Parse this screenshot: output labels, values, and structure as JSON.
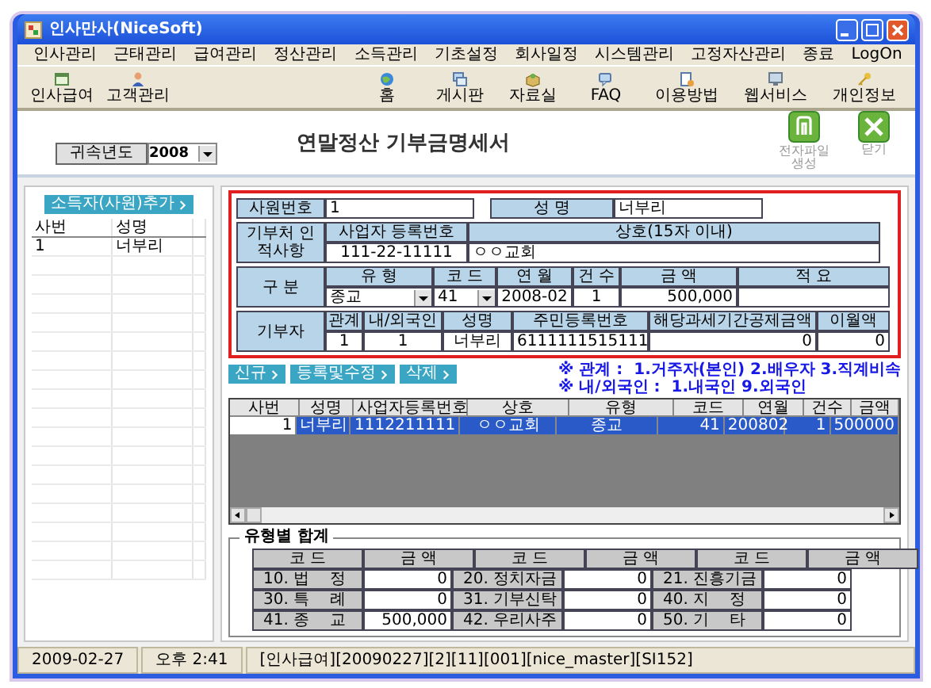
{
  "window": {
    "title": "인사만사(NiceSoft)"
  },
  "menu": [
    "인사관리",
    "근태관리",
    "급여관리",
    "정산관리",
    "소득관리",
    "기초설정",
    "회사일정",
    "시스템관리",
    "고정자산관리",
    "종료",
    "LogOn"
  ],
  "toolbar_left": [
    {
      "label": "인사급여",
      "kind": "calendar"
    },
    {
      "label": "고객관리",
      "kind": "person"
    }
  ],
  "toolbar_right": [
    {
      "label": "홈",
      "kind": "globe"
    },
    {
      "label": "게시판",
      "kind": "board"
    },
    {
      "label": "자료실",
      "kind": "box"
    },
    {
      "label": "FAQ",
      "kind": "chat"
    },
    {
      "label": "이용방법",
      "kind": "guide"
    },
    {
      "label": "웹서비스",
      "kind": "monitor"
    },
    {
      "label": "개인정보",
      "kind": "key"
    }
  ],
  "year": {
    "label": "귀속년도",
    "value": "2008"
  },
  "page_title": "연말정산 기부금명세서",
  "actions": [
    {
      "label": "전자파일 생성",
      "kind": "file"
    },
    {
      "label": "닫기",
      "kind": "close"
    }
  ],
  "employee_panel": {
    "button": "소득자(사원)추가",
    "columns": [
      "사번",
      "성명"
    ],
    "rows": [
      [
        "1",
        "너부리"
      ]
    ]
  },
  "form": {
    "employee_no_label": "사원번호",
    "employee_no": "1",
    "name_label": "성 명",
    "name": "너부리",
    "donee": {
      "label": "기부처 인적사항",
      "columns": [
        "사업자 등록번호",
        "상호(15자 이내)"
      ],
      "values": [
        "111-22-11111",
        "ㅇㅇ교회"
      ]
    },
    "category": {
      "label": "구 분",
      "columns": [
        "유 형",
        "코 드",
        "연 월",
        "건 수",
        "금 액",
        "적 요"
      ],
      "values": [
        {
          "value": "종교",
          "kind": "select"
        },
        {
          "value": "41",
          "kind": "select"
        },
        {
          "value": "2008-02",
          "kind": "text"
        },
        {
          "value": "1",
          "kind": "text"
        },
        {
          "value": "500,000",
          "kind": "number"
        }
      ]
    },
    "donor": {
      "label": "기부자",
      "columns": [
        "관계",
        "내/외국인",
        "성명",
        "주민등록번호",
        "해당과세기간공제금액",
        "이월액"
      ],
      "values": [
        {
          "value": "1",
          "kind": "text"
        },
        {
          "value": "1",
          "kind": "text"
        },
        {
          "value": "너부리",
          "kind": "text"
        },
        {
          "value": "6111111515111",
          "kind": "text"
        },
        {
          "value": "0",
          "kind": "number"
        },
        {
          "value": "0",
          "kind": "number"
        }
      ]
    }
  },
  "buttons": [
    "신규",
    "등록및수정",
    "삭제"
  ],
  "notes": [
    "※ 관계 :  1.거주자(본인) 2.배우자 3.직계비속",
    "※ 내/외국인 :  1.내국인 9.외국인"
  ],
  "grid": {
    "columns": [
      "사번",
      "성명",
      "사업자등록번호",
      "상호",
      "유형",
      "코드",
      "연월",
      "건수",
      "금액"
    ],
    "rows": [
      {
        "cells": [
          "1",
          "너부리",
          "1112211111",
          "ㅇㅇ교회",
          "종교",
          "41",
          "200802",
          "1",
          "500000"
        ],
        "selected": true
      }
    ]
  },
  "summary": {
    "title": "유형별 합계",
    "header": [
      "코 드",
      "금 액",
      "코 드",
      "금 액",
      "코 드",
      "금 액"
    ],
    "rows": [
      [
        "10. 법    정",
        "0",
        "20. 정치자금",
        "0",
        "21. 진흥기금",
        "0"
      ],
      [
        "30. 특    례",
        "0",
        "31. 기부신탁",
        "0",
        "40. 지    정",
        "0"
      ],
      [
        "41. 종    교",
        "500,000",
        "42. 우리사주",
        "0",
        "50. 기    타",
        "0"
      ]
    ]
  },
  "status_bar": [
    "2009-02-27",
    "오후 2:41",
    "[인사급여][20090227][2][11][001][nice_master][SI152]"
  ]
}
